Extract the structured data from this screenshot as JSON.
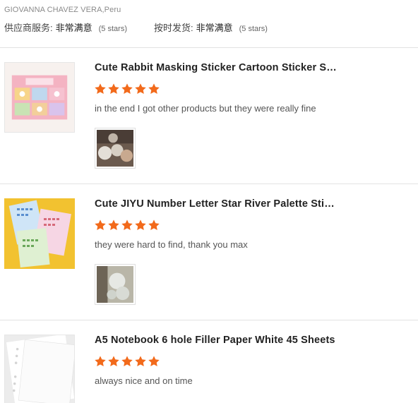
{
  "header": {
    "reviewer": "GIOVANNA CHAVEZ VERA,Peru",
    "ratings": [
      {
        "label": "供应商服务:",
        "value": "非常满意",
        "stars_text": "(5 stars)"
      },
      {
        "label": "按时发货:",
        "value": "非常满意",
        "stars_text": "(5 stars)"
      }
    ]
  },
  "colors": {
    "star": "#f26a1b",
    "divider": "#e2e2e2"
  },
  "reviews": [
    {
      "title": "Cute Rabbit Masking Sticker Cartoon Sticker S…",
      "rating": 5,
      "comment": "in the end I got other products but they were really fine",
      "has_photo": true
    },
    {
      "title": "Cute JIYU Number Letter Star River Palette Stic…",
      "rating": 5,
      "comment": "they were hard to find, thank you max",
      "has_photo": true
    },
    {
      "title": "A5 Notebook 6 hole Filler Paper White 45 Sheets",
      "rating": 5,
      "comment": "always nice and on time",
      "has_photo": false
    }
  ]
}
